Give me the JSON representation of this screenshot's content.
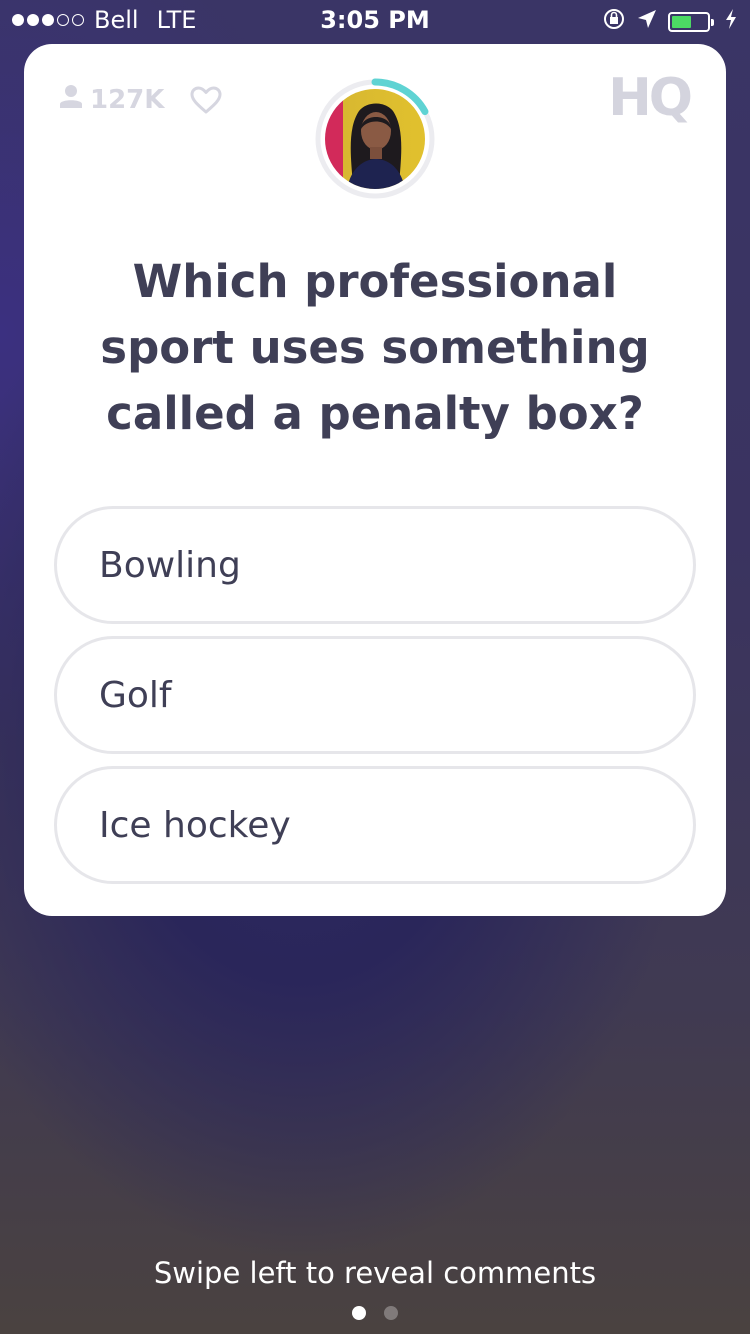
{
  "status_bar": {
    "carrier": "Bell",
    "network": "LTE",
    "time": "3:05 PM",
    "battery_level": 0.55,
    "battery_color": "#4cd964"
  },
  "card": {
    "viewer_count": "127K",
    "logo": "HQ",
    "host_timer_progress": 0.17,
    "question": "Which professional sport uses something called a penalty box?",
    "answers": [
      "Bowling",
      "Golf",
      "Ice hockey"
    ]
  },
  "footer": {
    "hint": "Swipe left to reveal comments",
    "pages": 2,
    "active_page": 1
  },
  "colors": {
    "text_primary": "#3f3f56",
    "timer_ring": "#5fd3d3"
  },
  "icons": [
    "user-icon",
    "heart-icon",
    "location-arrow-icon",
    "rotation-lock-icon",
    "charging-bolt-icon"
  ]
}
